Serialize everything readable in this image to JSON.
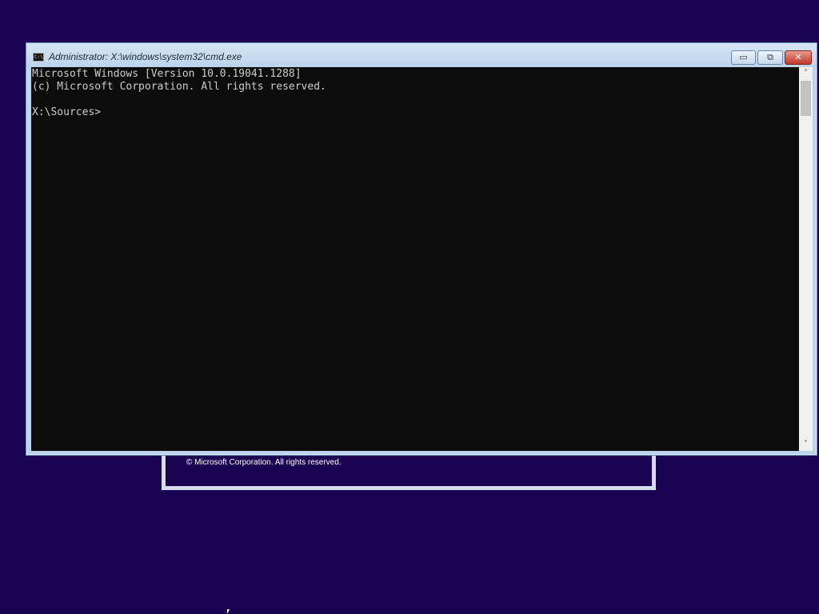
{
  "setup_dialog": {
    "copyright": "© Microsoft Corporation. All rights reserved."
  },
  "window": {
    "title": "Administrator: X:\\windows\\system32\\cmd.exe",
    "icon": "cmd-icon",
    "icon_label": "C:\\",
    "minimize_label": "▭",
    "maximize_label": "⧉",
    "close_label": "✕"
  },
  "console": {
    "lines": [
      "Microsoft Windows [Version 10.0.19041.1288]",
      "(c) Microsoft Corporation. All rights reserved.",
      "",
      "X:\\Sources>"
    ]
  },
  "scrollbar": {
    "up_icon": "˄",
    "down_icon": "˅"
  },
  "colors": {
    "desktop_background": "#1a0350",
    "console_background": "#0c0c0c",
    "console_text": "#cccccc",
    "close_button": "#c0392b"
  }
}
